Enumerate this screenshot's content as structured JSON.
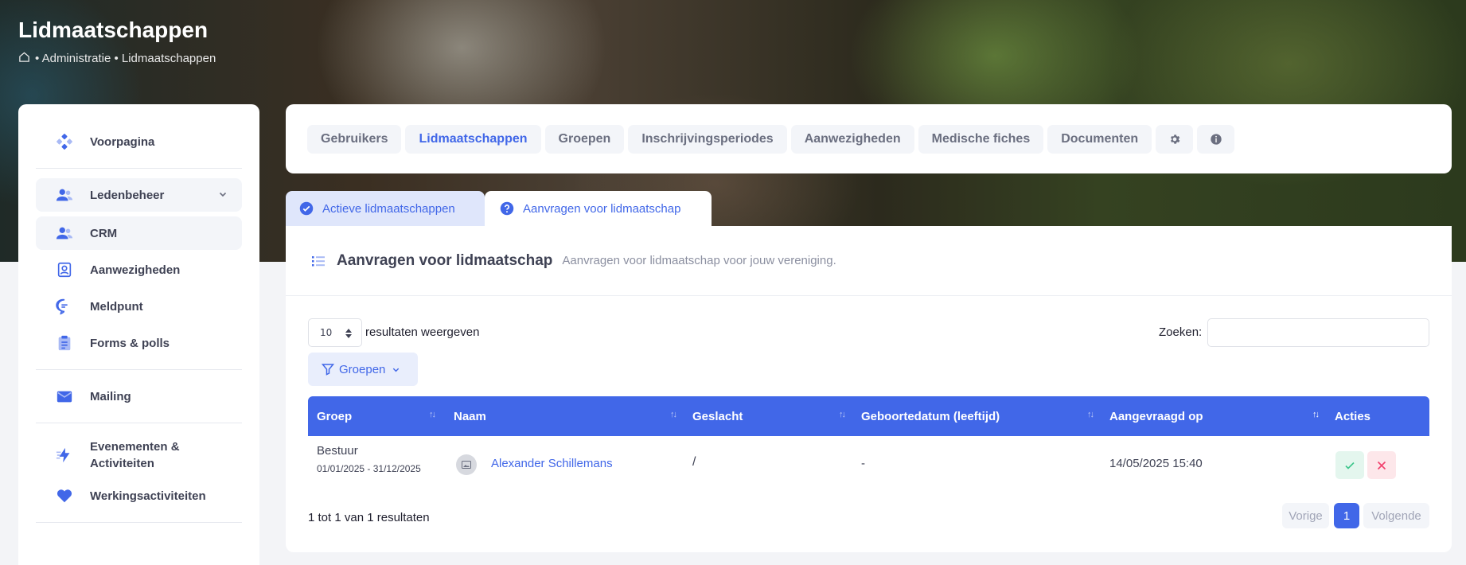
{
  "header": {
    "title": "Lidmaatschappen",
    "breadcrumb": "• Administratie • Lidmaatschappen"
  },
  "sidebar": {
    "items": [
      {
        "label": "Voorpagina",
        "icon": "grid-dots-icon"
      },
      {
        "label": "Ledenbeheer",
        "icon": "users-icon"
      },
      {
        "label": "CRM",
        "icon": "users-icon"
      },
      {
        "label": "Aanwezigheden",
        "icon": "badge-icon"
      },
      {
        "label": "Meldpunt",
        "icon": "chat-icon"
      },
      {
        "label": "Forms & polls",
        "icon": "clipboard-icon"
      },
      {
        "label": "Mailing",
        "icon": "envelope-icon"
      },
      {
        "label": "Evenementen & Activiteiten",
        "icon": "lightning-icon"
      },
      {
        "label": "Werkingsactiviteiten",
        "icon": "heart-icon"
      }
    ]
  },
  "tabs": [
    "Gebruikers",
    "Lidmaatschappen",
    "Groepen",
    "Inschrijvingsperiodes",
    "Aanwezigheden",
    "Medische fiches",
    "Documenten"
  ],
  "subtabs": {
    "active_memberships": "Actieve lidmaatschappen",
    "requests": "Aanvragen voor lidmaatschap"
  },
  "card": {
    "title": "Aanvragen voor lidmaatschap",
    "subtitle": "Aanvragen voor lidmaatschap voor jouw vereniging."
  },
  "controls": {
    "page_length": "10",
    "page_length_label": "resultaten weergeven",
    "search_label": "Zoeken:",
    "search_value": "",
    "filter_label": "Groepen"
  },
  "table": {
    "columns": [
      "Groep",
      "Naam",
      "Geslacht",
      "Geboortedatum (leeftijd)",
      "Aangevraagd op",
      "Acties"
    ],
    "rows": [
      {
        "group": "Bestuur",
        "group_period": "01/01/2025 - 31/12/2025",
        "name": "Alexander Schillemans",
        "gender": "/",
        "birthdate": "-",
        "requested_on": "14/05/2025 15:40"
      }
    ]
  },
  "pagination": {
    "info": "1 tot 1 van 1 resultaten",
    "prev": "Vorige",
    "current": "1",
    "next": "Volgende"
  },
  "colors": {
    "accent": "#4167e8",
    "approve_bg": "#e4f6ee",
    "reject_bg": "#fde7ea"
  }
}
